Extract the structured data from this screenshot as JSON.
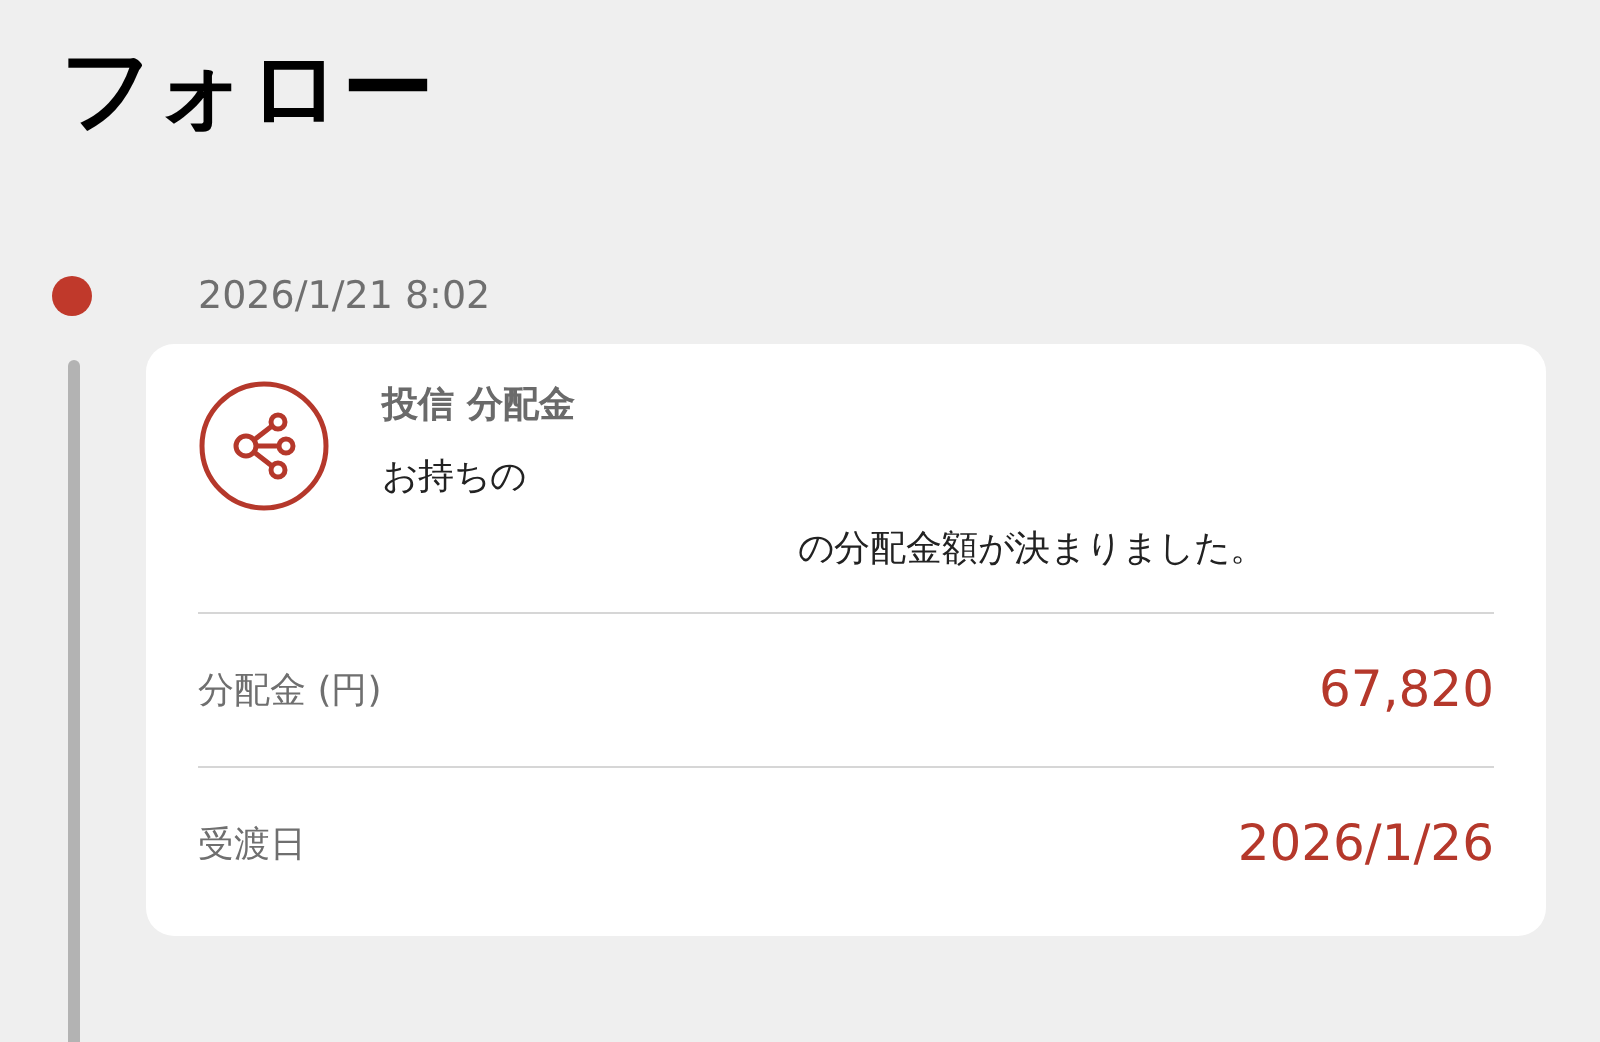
{
  "page_title": "フォロー",
  "timeline": [
    {
      "time": "2026/1/21 8:02",
      "category": "投信 分配金",
      "message_start": "お持ちの",
      "message_end": "の分配金額が決まりました。",
      "rows": [
        {
          "label": "分配金 (円)",
          "value": "67,820"
        },
        {
          "label": "受渡日",
          "value": "2026/1/26"
        }
      ]
    }
  ]
}
